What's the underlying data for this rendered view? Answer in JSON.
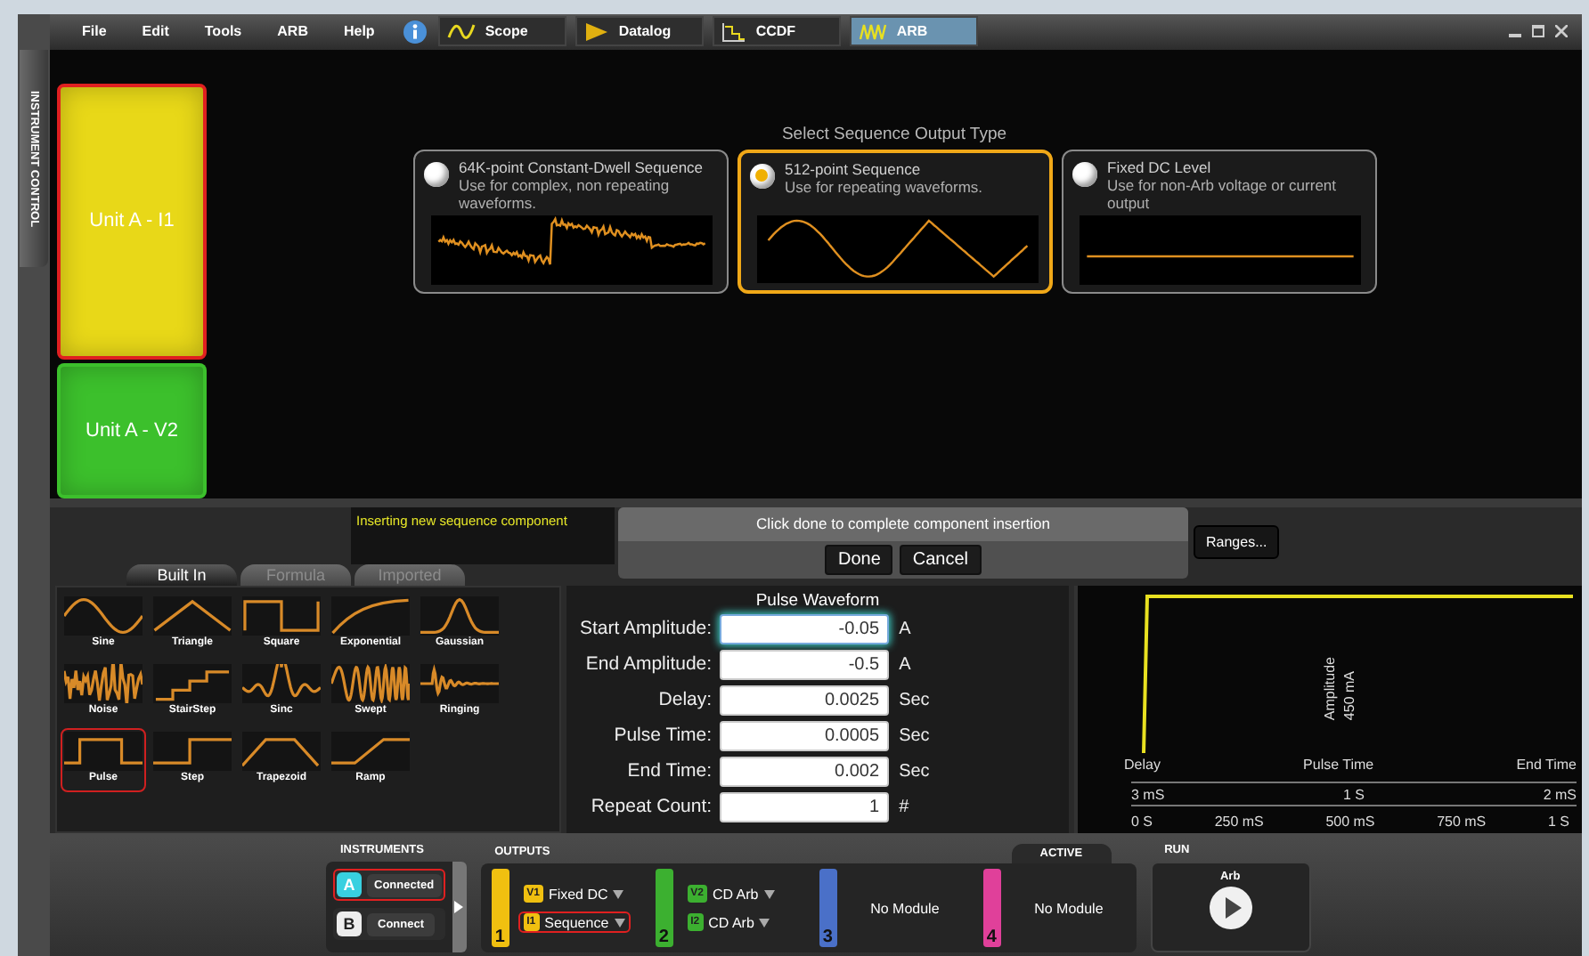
{
  "menu": [
    "File",
    "Edit",
    "Tools",
    "ARB",
    "Help"
  ],
  "app_tabs": [
    {
      "label": "Scope",
      "selected": false
    },
    {
      "label": "Datalog",
      "selected": false
    },
    {
      "label": "CCDF",
      "selected": false
    },
    {
      "label": "ARB",
      "selected": true
    }
  ],
  "side_tab": "INSTRUMENT CONTROL",
  "units": [
    {
      "label": "Unit A - I1",
      "color": "#e8d818",
      "selected": true
    },
    {
      "label": "Unit A - V2",
      "color": "#3cc02c",
      "selected": false
    }
  ],
  "sequence_type": {
    "title": "Select Sequence Output Type",
    "options": [
      {
        "title": "64K-point Constant-Dwell Sequence",
        "description": "Use for complex, non repeating waveforms.",
        "kind": "noisy",
        "selected": false
      },
      {
        "title": "512-point Sequence",
        "description": "Use for repeating waveforms.",
        "kind": "periodic",
        "selected": true
      },
      {
        "title": "Fixed DC Level",
        "description": "Use for non-Arb voltage or current output",
        "kind": "flat",
        "selected": false
      }
    ]
  },
  "status_message": "Inserting new sequence component",
  "insert_prompt": {
    "text": "Click done to complete component insertion",
    "buttons": [
      "Done",
      "Cancel"
    ]
  },
  "ranges_button": "Ranges...",
  "library": {
    "tabs": [
      {
        "label": "Built In",
        "selected": true
      },
      {
        "label": "Formula",
        "selected": false
      },
      {
        "label": "Imported",
        "selected": false
      }
    ],
    "items": [
      {
        "label": "Sine",
        "kind": "sine",
        "selected": false
      },
      {
        "label": "Triangle",
        "kind": "triangle",
        "selected": false
      },
      {
        "label": "Square",
        "kind": "square",
        "selected": false
      },
      {
        "label": "Exponential",
        "kind": "exponential",
        "selected": false
      },
      {
        "label": "Gaussian",
        "kind": "gaussian",
        "selected": false
      },
      {
        "label": "Noise",
        "kind": "noise",
        "selected": false
      },
      {
        "label": "StairStep",
        "kind": "stairstep",
        "selected": false
      },
      {
        "label": "Sinc",
        "kind": "sinc",
        "selected": false
      },
      {
        "label": "Swept",
        "kind": "swept",
        "selected": false
      },
      {
        "label": "Ringing",
        "kind": "ringing",
        "selected": false
      },
      {
        "label": "Pulse",
        "kind": "pulse",
        "selected": true
      },
      {
        "label": "Step",
        "kind": "step",
        "selected": false
      },
      {
        "label": "Trapezoid",
        "kind": "trapezoid",
        "selected": false
      },
      {
        "label": "Ramp",
        "kind": "ramp",
        "selected": false
      }
    ]
  },
  "params": {
    "title": "Pulse Waveform",
    "fields": [
      {
        "label": "Start Amplitude:",
        "value": "-0.05",
        "unit": "A",
        "focused": true
      },
      {
        "label": "End Amplitude:",
        "value": "-0.5",
        "unit": "A",
        "focused": false
      },
      {
        "label": "Delay:",
        "value": "0.0025",
        "unit": "Sec",
        "focused": false
      },
      {
        "label": "Pulse Time:",
        "value": "0.0005",
        "unit": "Sec",
        "focused": false
      },
      {
        "label": "End Time:",
        "value": "0.002",
        "unit": "Sec",
        "focused": false
      },
      {
        "label": "Repeat Count:",
        "value": "1",
        "unit": "#",
        "focused": false
      }
    ]
  },
  "preview": {
    "amplitude_label": "Amplitude",
    "amplitude_value": "450 mA",
    "markers": [
      {
        "label": "Delay",
        "value": "3 mS"
      },
      {
        "label": "Pulse Time",
        "value": "1 S"
      },
      {
        "label": "End Time",
        "value": "2 mS"
      }
    ],
    "axis": [
      "0 S",
      "250 mS",
      "500 mS",
      "750 mS",
      "1 S"
    ]
  },
  "bottom": {
    "instruments_title": "INSTRUMENTS",
    "instruments": [
      {
        "letter": "A",
        "button": "Connected",
        "connected": true,
        "highlighted": true
      },
      {
        "letter": "B",
        "button": "Connect",
        "connected": false,
        "highlighted": false
      }
    ],
    "outputs_title": "OUTPUTS",
    "active_label": "ACTIVE",
    "outputs": [
      {
        "number": "1",
        "color": "#f0c010",
        "channels": [
          {
            "tag": "V1",
            "label": "Fixed DC",
            "highlighted": false
          },
          {
            "tag": "I1",
            "label": "Sequence",
            "highlighted": true
          }
        ]
      },
      {
        "number": "2",
        "color": "#3cb030",
        "channels": [
          {
            "tag": "V2",
            "label": "CD Arb",
            "highlighted": false
          },
          {
            "tag": "I2",
            "label": "CD Arb",
            "highlighted": false
          }
        ]
      },
      {
        "number": "3",
        "color": "#4a70c8",
        "module": "No Module"
      },
      {
        "number": "4",
        "color": "#e0409a",
        "module": "No Module"
      }
    ],
    "run_title": "RUN",
    "run_label": "Arb"
  }
}
